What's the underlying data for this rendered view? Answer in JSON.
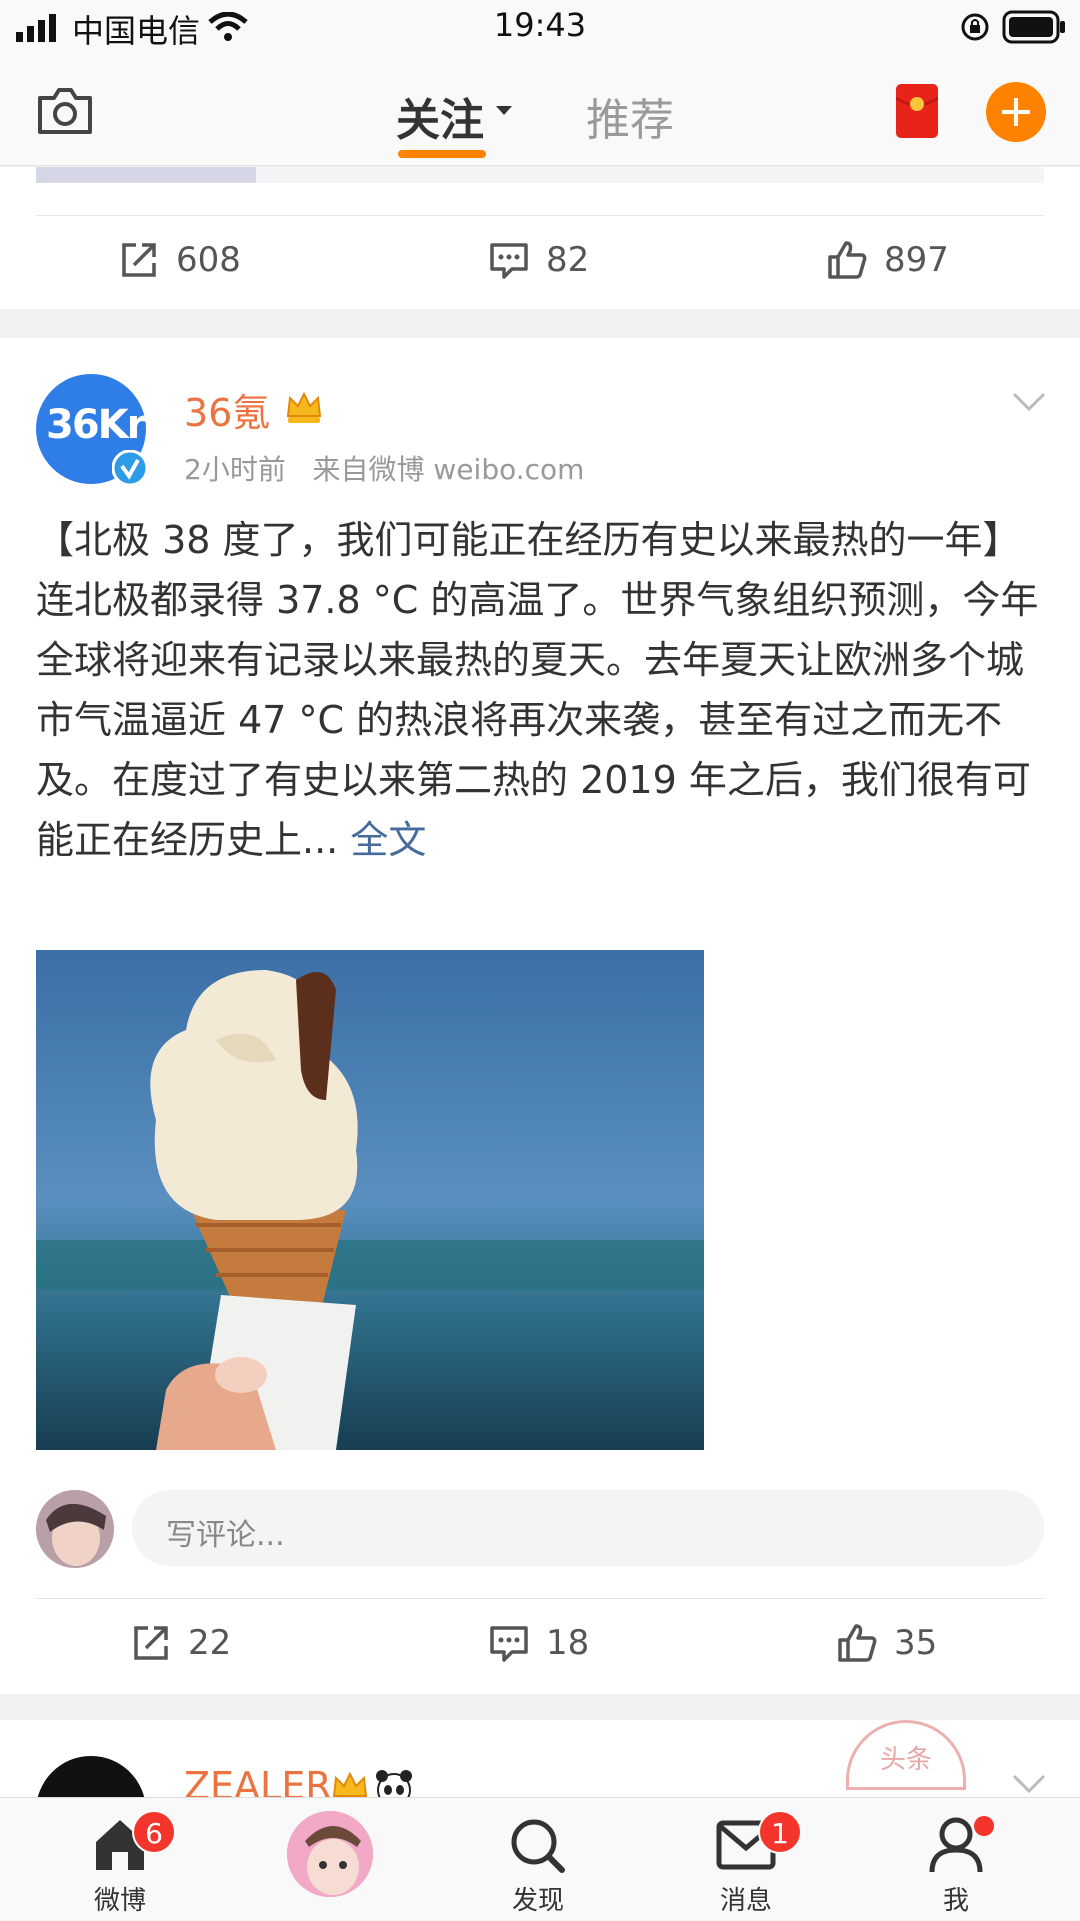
{
  "status_bar": {
    "carrier": "中国电信",
    "time": "19:43"
  },
  "top_nav": {
    "active_tab": "关注",
    "inactive_tab": "推荐"
  },
  "prev_post": {
    "reposts": "608",
    "comments": "82",
    "likes": "897"
  },
  "post": {
    "avatar_text": "36Kr",
    "author": "36氪",
    "meta": "2小时前   来自微博 weibo.com",
    "text": "【北极 38 度了，我们可能正在经历有史以来最热的一年】连北极都录得 37.8 °C 的高温了。世界气象组织预测，今年全球将迎来有记录以来最热的夏天。去年夏天让欧洲多个城市气温逼近 47 °C 的热浪将再次来袭，甚至有过之而无不及。在度过了有史以来第二热的 2019 年之后，我们很有可能正在经历史上...",
    "more_link": "全文",
    "comment_placeholder": "写评论...",
    "reposts": "22",
    "comments": "18",
    "likes": "35"
  },
  "next_post": {
    "author": "ZEALER",
    "stamp_text": "头条"
  },
  "bottom_nav": {
    "home_label": "微博",
    "home_badge": "6",
    "discover_label": "发现",
    "messages_label": "消息",
    "messages_badge": "1",
    "me_label": "我"
  },
  "colors": {
    "accent": "#ff8200",
    "author": "#eb7340",
    "link": "#466a9c",
    "badge": "#f4352c"
  }
}
